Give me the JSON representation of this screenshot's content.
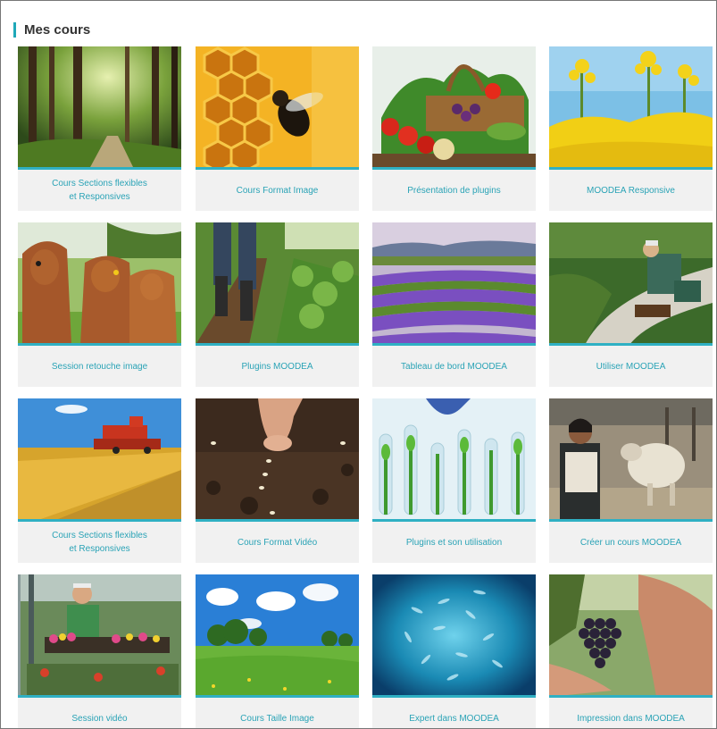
{
  "section": {
    "title": "Mes cours"
  },
  "courses": [
    {
      "label": "Cours Sections flexibles\net Responsives",
      "image": "forest-path"
    },
    {
      "label": "Cours Format Image",
      "image": "bee-honeycomb"
    },
    {
      "label": "Présentation de plugins",
      "image": "vegetable-basket"
    },
    {
      "label": "MOODEA Responsive",
      "image": "rapeseed-flowers"
    },
    {
      "label": "Session retouche image",
      "image": "cows-in-field"
    },
    {
      "label": "Plugins MOODEA",
      "image": "farmer-in-rows"
    },
    {
      "label": "Tableau de bord MOODEA",
      "image": "lavender-field"
    },
    {
      "label": "Utiliser MOODEA",
      "image": "laying-turf"
    },
    {
      "label": "Cours Sections flexibles\net Responsives",
      "image": "combine-harvester"
    },
    {
      "label": "Cours Format Vidéo",
      "image": "planting-seeds"
    },
    {
      "label": "Plugins et son utilisation",
      "image": "lab-plants"
    },
    {
      "label": "Créer un cours MOODEA",
      "image": "woman-with-sheep"
    },
    {
      "label": "Session vidéo",
      "image": "greenhouse-worker"
    },
    {
      "label": "Cours Taille Image",
      "image": "green-meadow"
    },
    {
      "label": "Expert dans MOODEA",
      "image": "fish-school"
    },
    {
      "label": "Impression dans MOODEA",
      "image": "grape-harvest"
    }
  ]
}
